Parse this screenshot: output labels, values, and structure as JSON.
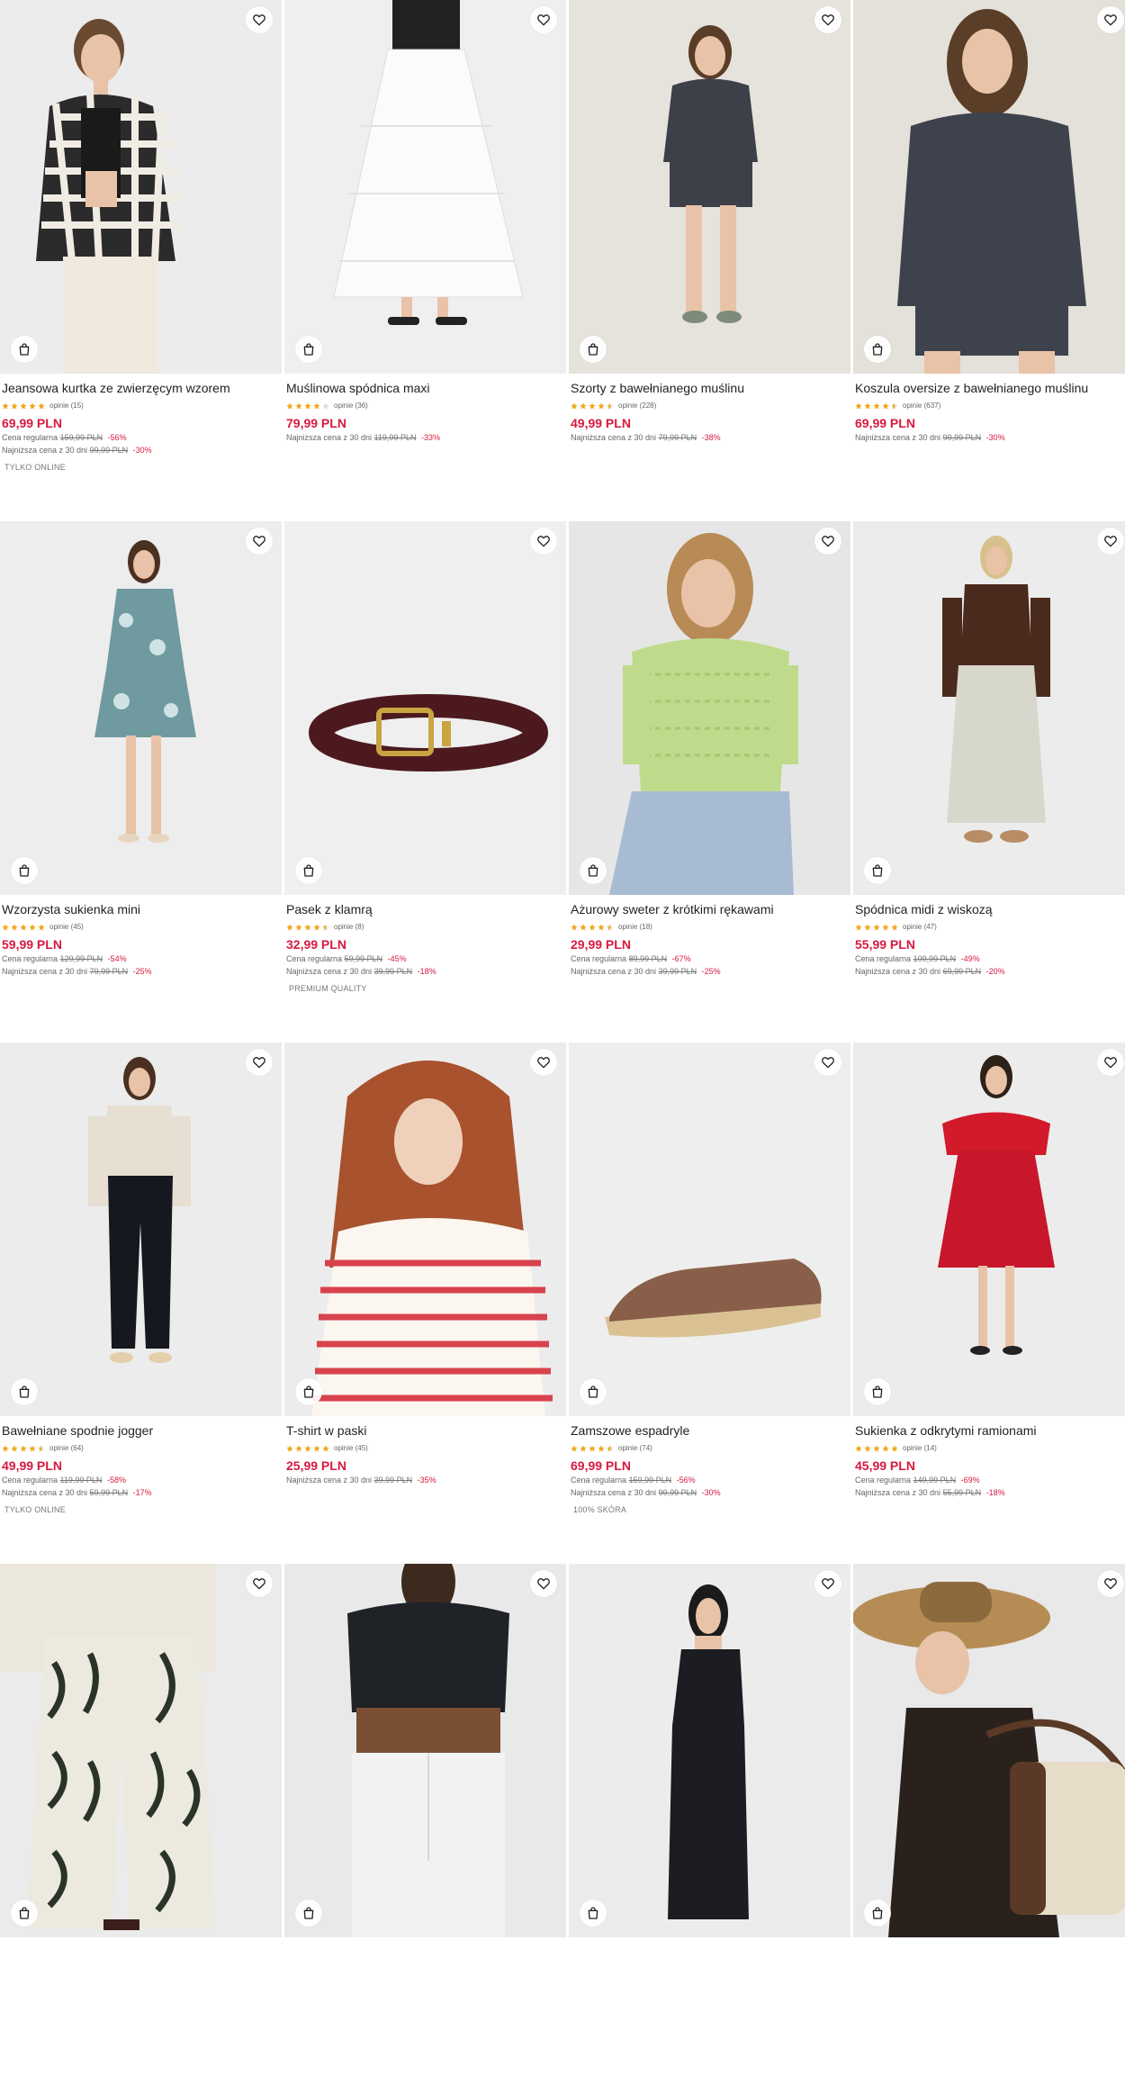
{
  "products": [
    {
      "name": "Jeansowa kurtka ze zwierzęcym wzorem",
      "stars": 5,
      "reviews": "opinie (15)",
      "price": "69,99 PLN",
      "regular_label": "Cena regularna",
      "regular_old": "159,99 PLN",
      "regular_disc": "-56%",
      "lowest_label": "Najniższa cena z 30 dni",
      "lowest_old": "99,99 PLN",
      "lowest_disc": "-30%",
      "badge": "TYLKO ONLINE",
      "photo": "zebra-jacket",
      "bg": "#ececec"
    },
    {
      "name": "Muślinowa spódnica maxi",
      "stars": 4,
      "reviews": "opinie (36)",
      "price": "79,99 PLN",
      "lowest_label": "Najniższa cena z 30 dni",
      "lowest_old": "119,99 PLN",
      "lowest_disc": "-33%",
      "photo": "white-skirt",
      "bg": "#efefef"
    },
    {
      "name": "Szorty z bawełnianego muślinu",
      "stars": 4.5,
      "reviews": "opinie (228)",
      "price": "49,99 PLN",
      "lowest_label": "Najniższa cena z 30 dni",
      "lowest_old": "79,99 PLN",
      "lowest_disc": "-38%",
      "photo": "grey-set",
      "bg": "#e6e2dc"
    },
    {
      "name": "Koszula oversize z bawełnianego muślinu",
      "stars": 4.5,
      "reviews": "opinie (637)",
      "price": "69,99 PLN",
      "lowest_label": "Najniższa cena z 30 dni",
      "lowest_old": "99,99 PLN",
      "lowest_disc": "-30%",
      "photo": "grey-shirt",
      "bg": "#e4e0da"
    },
    {
      "name": "Wzorzysta sukienka mini",
      "stars": 5,
      "reviews": "opinie (45)",
      "price": "59,99 PLN",
      "regular_label": "Cena regularna",
      "regular_old": "129,99 PLN",
      "regular_disc": "-54%",
      "lowest_label": "Najniższa cena z 30 dni",
      "lowest_old": "79,99 PLN",
      "lowest_disc": "-25%",
      "photo": "floral-dress",
      "bg": "#ededed"
    },
    {
      "name": "Pasek z klamrą",
      "stars": 4.5,
      "reviews": "opinie (8)",
      "price": "32,99 PLN",
      "regular_label": "Cena regularna",
      "regular_old": "59,99 PLN",
      "regular_disc": "-45%",
      "lowest_label": "Najniższa cena z 30 dni",
      "lowest_old": "39,99 PLN",
      "lowest_disc": "-18%",
      "badge": "PREMIUM QUALITY",
      "photo": "belt",
      "bg": "#efefef"
    },
    {
      "name": "Ażurowy sweter z krótkimi rękawami",
      "stars": 4.5,
      "reviews": "opinie (18)",
      "price": "29,99 PLN",
      "regular_label": "Cena regularna",
      "regular_old": "89,99 PLN",
      "regular_disc": "-67%",
      "lowest_label": "Najniższa cena z 30 dni",
      "lowest_old": "39,99 PLN",
      "lowest_disc": "-25%",
      "photo": "green-sweater",
      "bg": "#e6e6e6"
    },
    {
      "name": "Spódnica midi z wiskozą",
      "stars": 5,
      "reviews": "opinie (47)",
      "price": "55,99 PLN",
      "regular_label": "Cena regularna",
      "regular_old": "109,99 PLN",
      "regular_disc": "-49%",
      "lowest_label": "Najniższa cena z 30 dni",
      "lowest_old": "69,99 PLN",
      "lowest_disc": "-20%",
      "photo": "midi-skirt",
      "bg": "#ececec"
    },
    {
      "name": "Bawełniane spodnie jogger",
      "stars": 4.5,
      "reviews": "opinie (64)",
      "price": "49,99 PLN",
      "regular_label": "Cena regularna",
      "regular_old": "119,99 PLN",
      "regular_disc": "-58%",
      "lowest_label": "Najniższa cena z 30 dni",
      "lowest_old": "59,99 PLN",
      "lowest_disc": "-17%",
      "badge": "TYLKO ONLINE",
      "photo": "jogger",
      "bg": "#ececec"
    },
    {
      "name": "T-shirt w paski",
      "stars": 5,
      "reviews": "opinie (45)",
      "price": "25,99 PLN",
      "lowest_label": "Najniższa cena z 30 dni",
      "lowest_old": "39,99 PLN",
      "lowest_disc": "-35%",
      "photo": "striped-tee",
      "bg": "#ececec"
    },
    {
      "name": "Zamszowe espadryle",
      "stars": 4.5,
      "reviews": "opinie (74)",
      "price": "69,99 PLN",
      "regular_label": "Cena regularna",
      "regular_old": "159,99 PLN",
      "regular_disc": "-56%",
      "lowest_label": "Najniższa cena z 30 dni",
      "lowest_old": "99,99 PLN",
      "lowest_disc": "-30%",
      "badge": "100% SKÓRA",
      "photo": "espadrille",
      "bg": "#eeeeee"
    },
    {
      "name": "Sukienka z odkrytymi ramionami",
      "stars": 5,
      "reviews": "opinie (14)",
      "price": "45,99 PLN",
      "regular_label": "Cena regularna",
      "regular_old": "149,99 PLN",
      "regular_disc": "-69%",
      "lowest_label": "Najniższa cena z 30 dni",
      "lowest_old": "55,99 PLN",
      "lowest_disc": "-18%",
      "photo": "red-dress",
      "bg": "#ececec"
    },
    {
      "photo": "leaf-pants",
      "bg": "#ebebeb"
    },
    {
      "photo": "black-crop",
      "bg": "#e9e9e9"
    },
    {
      "photo": "black-slip",
      "bg": "#ececec"
    },
    {
      "photo": "hat-bag",
      "bg": "#e9e9e9"
    }
  ],
  "colors": {
    "price": "#d7193f",
    "star": "#f2a71e",
    "star_empty": "#dddddd"
  },
  "icons": {
    "favorite": "heart-icon",
    "add_to_cart": "shopping-bag-icon"
  }
}
